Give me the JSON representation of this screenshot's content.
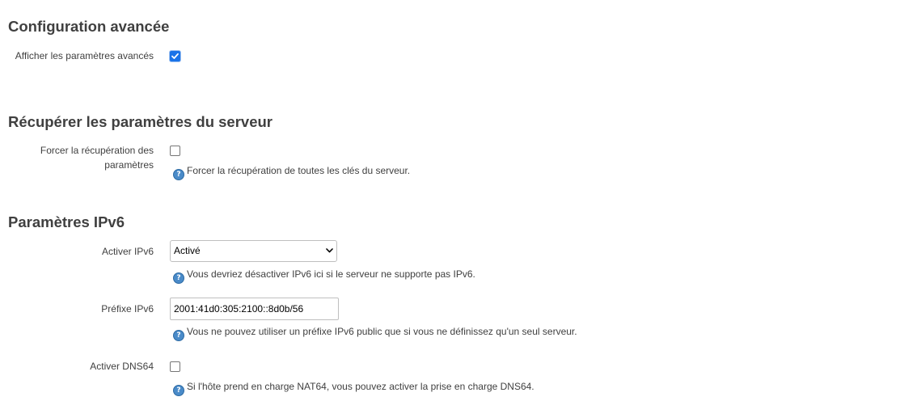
{
  "advanced": {
    "title": "Configuration avancée",
    "show_label": "Afficher les paramètres avancés",
    "show_checked": true
  },
  "server": {
    "title": "Récupérer les paramètres du serveur",
    "force_label": "Forcer la récupération des paramètres",
    "force_checked": false,
    "force_help": "Forcer la récupération de toutes les clés du serveur."
  },
  "ipv6": {
    "title": "Paramètres IPv6",
    "enable_label": "Activer IPv6",
    "enable_value": "Activé",
    "enable_help": "Vous devriez désactiver IPv6 ici si le serveur ne supporte pas IPv6.",
    "prefix_label": "Préfixe IPv6",
    "prefix_value": "2001:41d0:305:2100::8d0b/56",
    "prefix_help": "Vous ne pouvez utiliser un préfixe IPv6 public que si vous ne définissez qu'un seul serveur.",
    "dns64_label": "Activer DNS64",
    "dns64_checked": false,
    "dns64_help": "Si l'hôte prend en charge NAT64, vous pouvez activer la prise en charge DNS64."
  },
  "colors": {
    "text": "#404040",
    "checkbox_accent": "#1a73e8",
    "help_icon": "#4a8bc9"
  },
  "icons": {
    "help": "help-icon",
    "check": "check-icon",
    "dropdown": "chevron-down-icon"
  }
}
